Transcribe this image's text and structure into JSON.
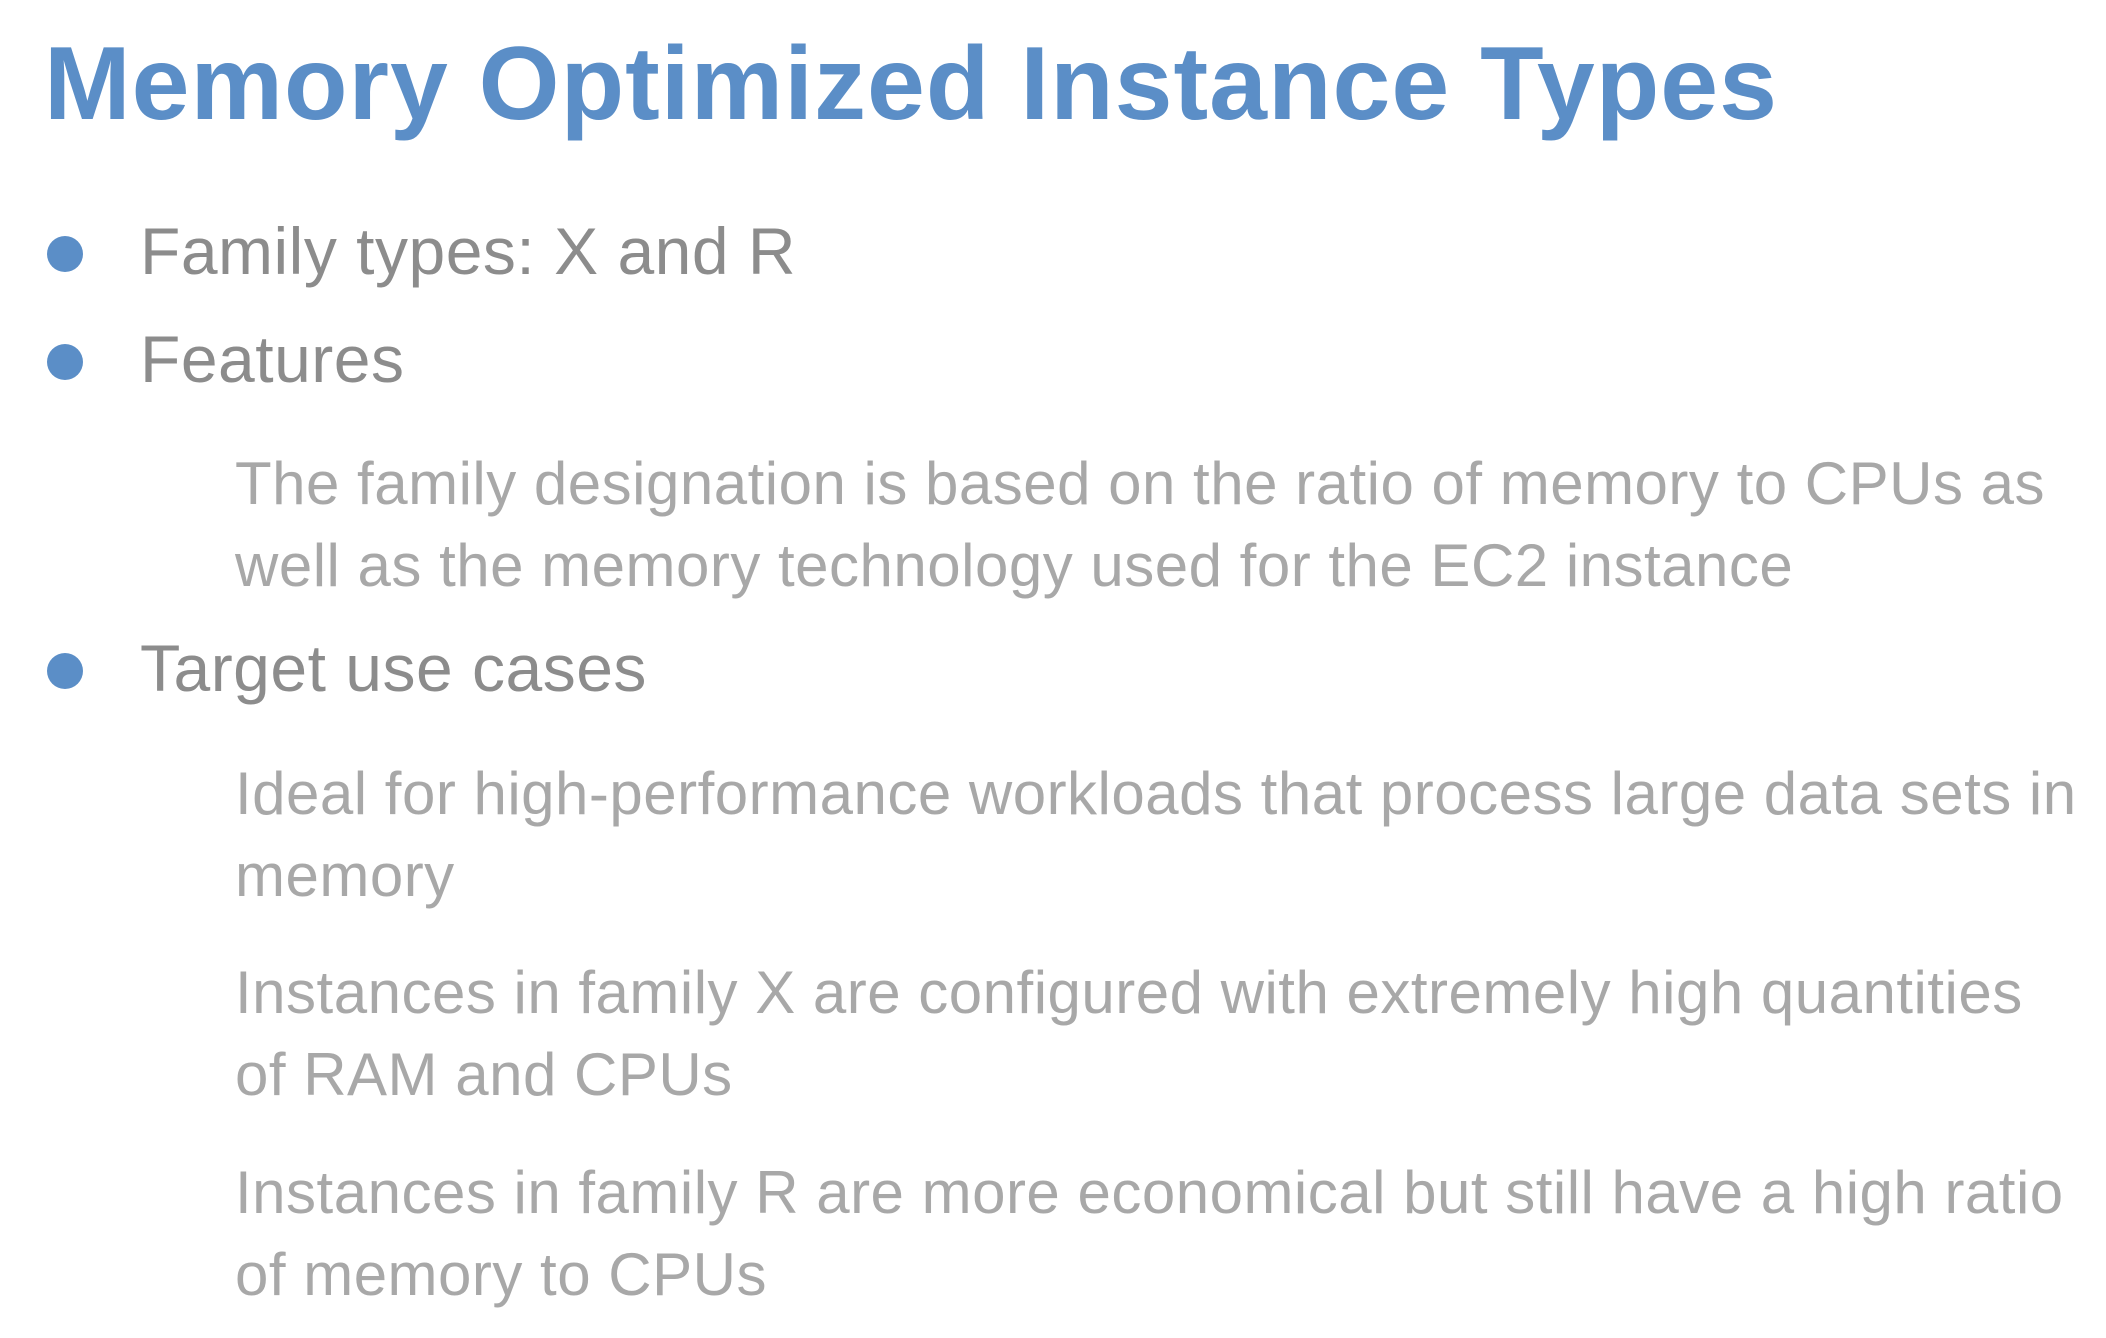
{
  "slide": {
    "title": "Memory Optimized Instance Types",
    "colors": {
      "title": "#5b8ec7",
      "bullet_dot": "#5b8ec7",
      "bullet_text": "#8c8c8c",
      "sub_text": "#a8a8a8",
      "background": "#ffffff"
    },
    "bullets": [
      {
        "label": "Family types: X and R",
        "details": []
      },
      {
        "label": "Features",
        "details": [
          "The family designation is based on the ratio of memory to CPUs as well as the memory technology used for the EC2 instance"
        ]
      },
      {
        "label": "Target use cases",
        "details": [
          "Ideal for high-performance workloads that process large data sets in memory",
          "Instances in family X are configured with extremely high quantities of RAM and CPUs",
          "Instances in family R are more economical but still have a high ratio of memory to CPUs"
        ]
      }
    ]
  }
}
